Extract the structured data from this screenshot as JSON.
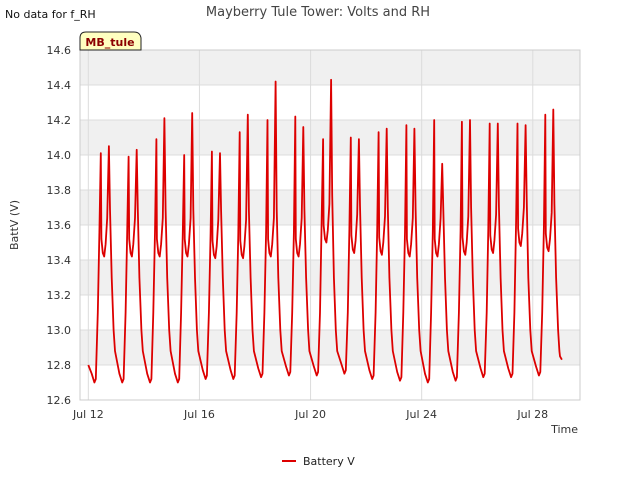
{
  "chart_data": {
    "type": "line",
    "title": "Mayberry Tule Tower: Volts and RH",
    "note": "No data for f_RH",
    "badge": "MB_tule",
    "xlabel": "Time",
    "ylabel": "BattV (V)",
    "ylim": [
      12.6,
      14.6
    ],
    "yticks": [
      "12.6",
      "12.8",
      "13.0",
      "13.2",
      "13.4",
      "13.6",
      "13.8",
      "14.0",
      "14.2",
      "14.4",
      "14.6"
    ],
    "xlim": [
      "Jul 12 00:00",
      "Jul 30 00:00"
    ],
    "xticks": [
      {
        "day": 12,
        "label": "Jul 12"
      },
      {
        "day": 16,
        "label": "Jul 16"
      },
      {
        "day": 20,
        "label": "Jul 20"
      },
      {
        "day": 24,
        "label": "Jul 24"
      },
      {
        "day": 28,
        "label": "Jul 28"
      }
    ],
    "grid": true,
    "legend_position": "bottom",
    "series": [
      {
        "name": "Battery V",
        "color": "#dd0000",
        "daily_cycle": {
          "start": "Jul 12",
          "days": 17,
          "min_v": [
            12.7,
            12.7,
            12.7,
            12.7,
            12.72,
            12.72,
            12.73,
            12.74,
            12.74,
            12.75,
            12.72,
            12.71,
            12.7,
            12.71,
            12.73,
            12.73,
            12.74
          ],
          "plateau_v": [
            13.44,
            13.44,
            13.44,
            13.44,
            13.43,
            13.43,
            13.44,
            13.44,
            13.52,
            13.46,
            13.45,
            13.44,
            13.44,
            13.45,
            13.46,
            13.5,
            13.47
          ],
          "peak1_v": [
            14.01,
            13.99,
            14.09,
            14.0,
            14.02,
            14.13,
            14.2,
            14.22,
            14.09,
            14.1,
            14.13,
            14.17,
            14.2,
            14.19,
            14.18,
            14.18,
            14.23
          ],
          "peak2_v": [
            14.05,
            14.03,
            14.21,
            14.24,
            14.01,
            14.23,
            14.42,
            14.16,
            14.43,
            14.09,
            14.15,
            14.15,
            13.95,
            14.2,
            14.18,
            14.17,
            14.26
          ]
        }
      }
    ]
  }
}
